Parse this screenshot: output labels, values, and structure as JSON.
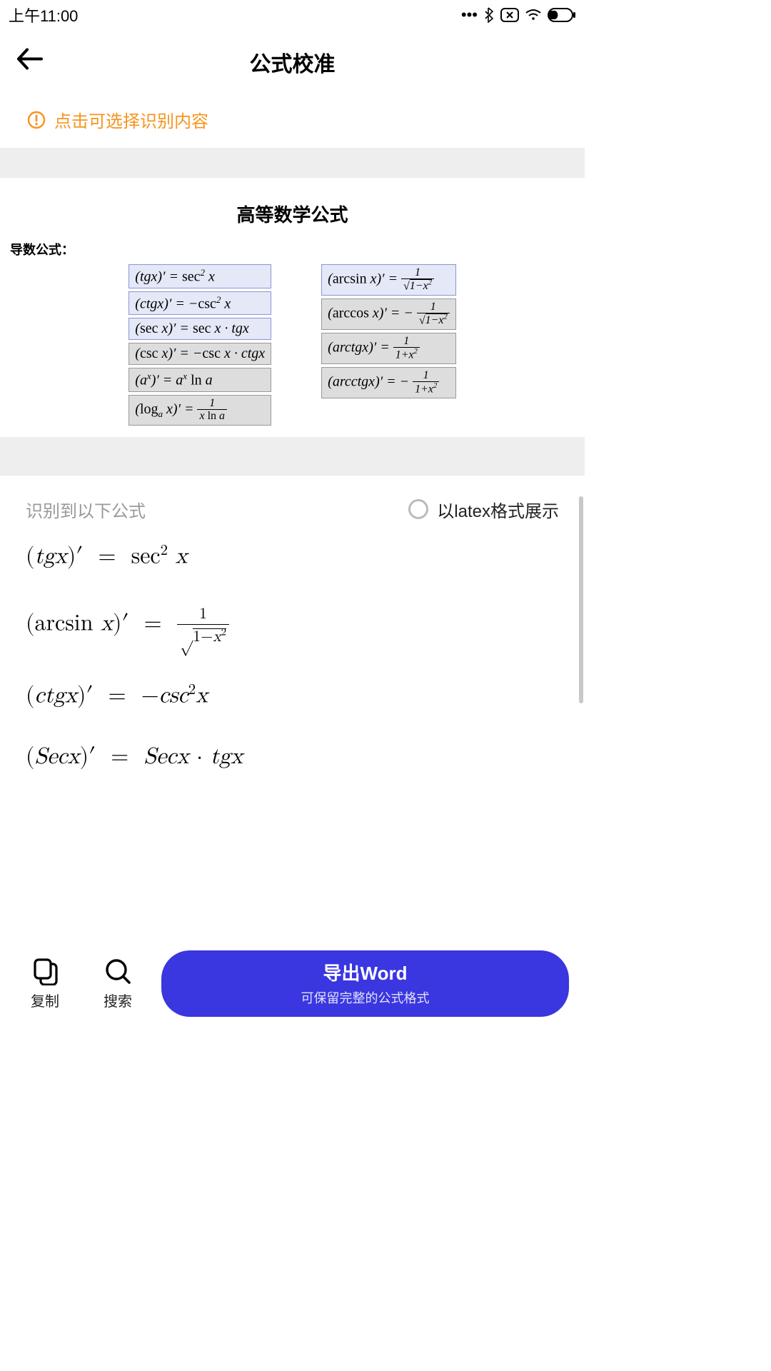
{
  "status": {
    "time": "上午11:00"
  },
  "header": {
    "title": "公式校准"
  },
  "tip": {
    "text": "点击可选择识别内容"
  },
  "image": {
    "title": "高等数学公式",
    "subtitle": "导数公式：",
    "left": [
      "(tgx)′ = sec² x",
      "(ctgx)′ = −csc² x",
      "(sec x)′ = sec x · tgx",
      "(csc x)′ = −csc x · ctgx",
      "(aˣ)′ = aˣ ln a",
      "(logₐ x)′ = 1 / (x ln a)"
    ],
    "right": [
      "(arcsin x)′ = 1 / √(1−x²)",
      "(arccos x)′ = − 1 / √(1−x²)",
      "(arctgx)′ = 1 / (1+x²)",
      "(arcctgx)′ = − 1 / (1+x²)"
    ]
  },
  "result": {
    "label": "识别到以下公式",
    "toggle": "以latex格式展示",
    "items": [
      "(tgx)′ = sec² x",
      "(arcsin x)′ = 1 / √(1−x²)",
      "(ctgx)′ = −csc²x",
      "(Secx)′ = Secx · tgx"
    ]
  },
  "bottom": {
    "copy": "复制",
    "search": "搜索",
    "export_title": "导出Word",
    "export_sub": "可保留完整的公式格式"
  }
}
